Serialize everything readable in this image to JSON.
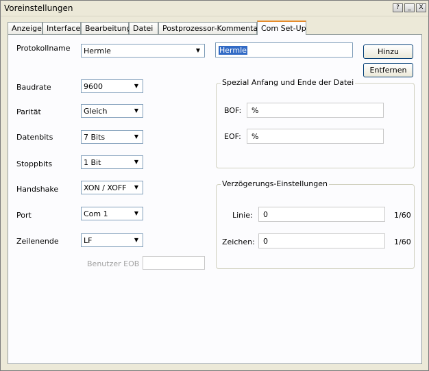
{
  "window": {
    "title": "Voreinstellungen",
    "buttons": {
      "help": "?",
      "minimize": "_",
      "close": "X"
    }
  },
  "tabs": [
    {
      "label": "Anzeige"
    },
    {
      "label": "Interface"
    },
    {
      "label": "Bearbeitung"
    },
    {
      "label": "Datei"
    },
    {
      "label": "Postprozessor-Kommentare"
    },
    {
      "label": "Com Set-Up",
      "active": true
    }
  ],
  "form": {
    "protokollname_label": "Protokollname",
    "protokollname_value": "Hermle",
    "protokollname_edit": "Hermle",
    "hinzu_button": "Hinzu",
    "entfernen_button": "Entfernen",
    "baudrate_label": "Baudrate",
    "baudrate_value": "9600",
    "paritaet_label": "Parität",
    "paritaet_value": "Gleich",
    "datenbits_label": "Datenbits",
    "datenbits_value": "7 Bits",
    "stoppbits_label": "Stoppbits",
    "stoppbits_value": "1 Bit",
    "handshake_label": "Handshake",
    "handshake_value": "XON / XOFF",
    "port_label": "Port",
    "port_value": "Com 1",
    "zeilenende_label": "Zeilenende",
    "zeilenende_value": "LF",
    "benutzer_eob_label": "Benutzer EOB",
    "benutzer_eob_value": ""
  },
  "spezial": {
    "title": "Spezial Anfang und Ende der Datei",
    "bof_label": "BOF:",
    "bof_value": "%",
    "eof_label": "EOF:",
    "eof_value": "%"
  },
  "verzoegerung": {
    "title": "Verzögerungs-Einstellungen",
    "linie_label": "Linie:",
    "linie_value": "0",
    "linie_unit": "1/60",
    "zeichen_label": "Zeichen:",
    "zeichen_value": "0",
    "zeichen_unit": "1/60"
  }
}
